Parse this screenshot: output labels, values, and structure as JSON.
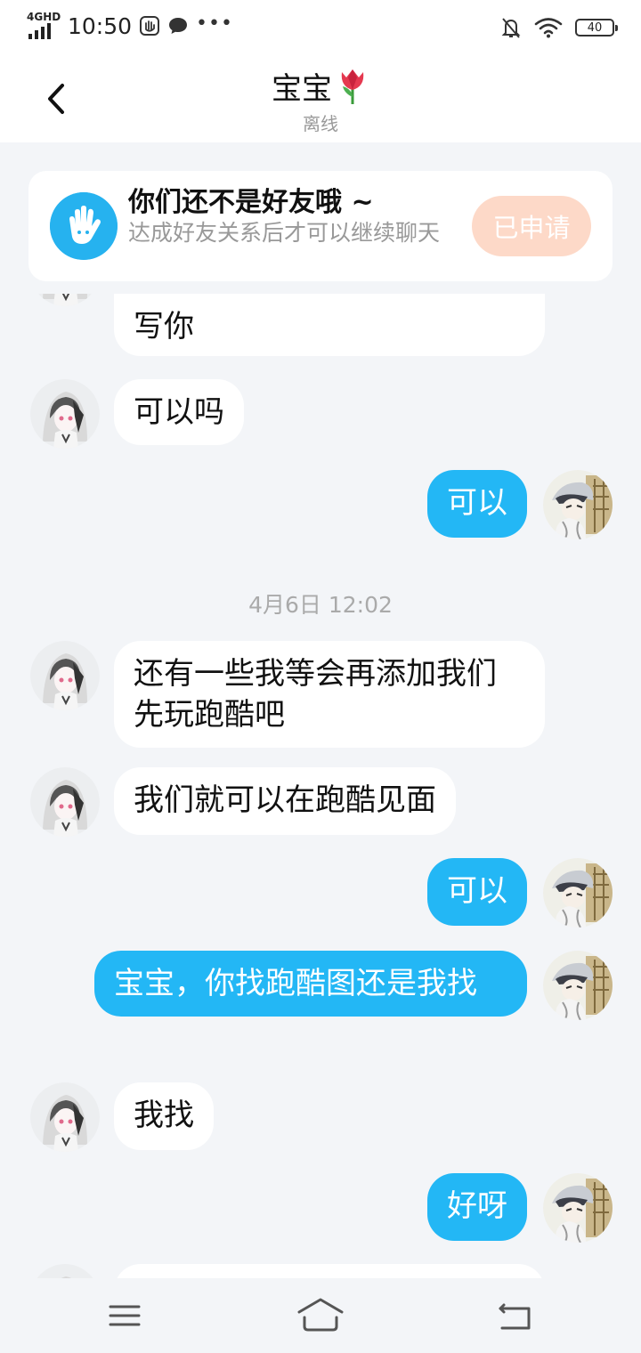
{
  "status_bar": {
    "network": "4GHD",
    "time": "10:50",
    "battery": "40",
    "icons": [
      "hand-notification-icon",
      "message-notification-icon",
      "more-dots-icon",
      "bell-off-icon",
      "wifi-icon",
      "battery-icon"
    ]
  },
  "header": {
    "title": "宝宝",
    "title_emoji": "🌷",
    "status": "离线"
  },
  "notice": {
    "title": "你们还不是好友哦 ~",
    "description": "达成好友关系后才可以继续聊天",
    "button": "已申请"
  },
  "messages": [
    {
      "side": "in",
      "text": "写你"
    },
    {
      "side": "in",
      "text": "可以吗"
    },
    {
      "side": "out",
      "text": "可以"
    },
    {
      "type": "timestamp",
      "text": "4月6日 12:02"
    },
    {
      "side": "in",
      "text": "还有一些我等会再添加我们先玩跑酷吧"
    },
    {
      "side": "in",
      "text": "我们就可以在跑酷见面"
    },
    {
      "side": "out",
      "text": "可以"
    },
    {
      "side": "out",
      "text": "宝宝，你找跑酷图还是我找"
    },
    {
      "side": "in",
      "text": "我找"
    },
    {
      "side": "out",
      "text": "好呀"
    }
  ],
  "colors": {
    "accent": "#23b7f5",
    "background": "#f3f5f8",
    "applied_button": "#fdd9c8"
  },
  "nav_bar": {
    "icons": [
      "menu-icon",
      "home-icon",
      "back-nav-icon"
    ]
  }
}
